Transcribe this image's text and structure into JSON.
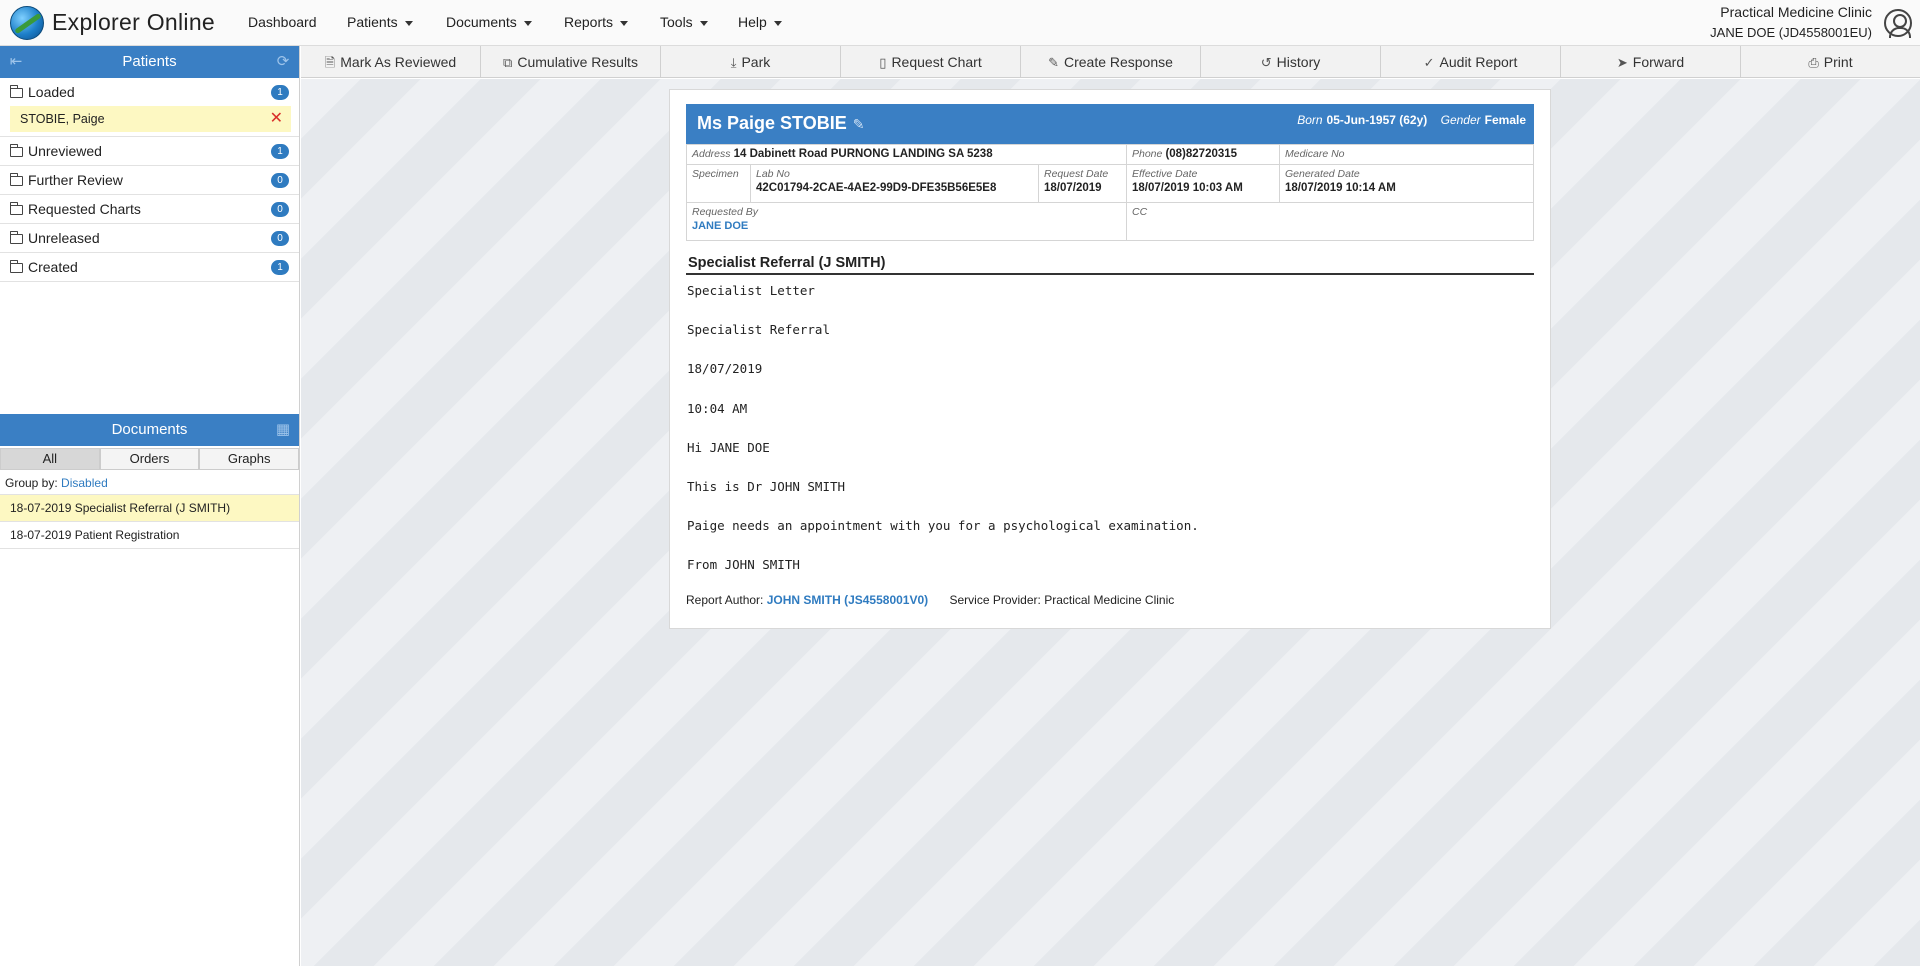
{
  "app": {
    "title": "Explorer Online"
  },
  "nav": {
    "items": [
      {
        "label": "Dashboard"
      },
      {
        "label": "Patients"
      },
      {
        "label": "Documents"
      },
      {
        "label": "Reports"
      },
      {
        "label": "Tools"
      },
      {
        "label": "Help"
      }
    ]
  },
  "user": {
    "clinic": "Practical Medicine Clinic",
    "name": "JANE DOE (JD4558001EU)"
  },
  "patients_panel": {
    "title": "Patients",
    "folders": [
      {
        "label": "Loaded",
        "count": "1"
      },
      {
        "label": "Unreviewed",
        "count": "1"
      },
      {
        "label": "Further Review",
        "count": "0"
      },
      {
        "label": "Requested Charts",
        "count": "0"
      },
      {
        "label": "Unreleased",
        "count": "0"
      },
      {
        "label": "Created",
        "count": "1"
      }
    ],
    "loaded_patient": "STOBIE, Paige"
  },
  "documents_panel": {
    "title": "Documents",
    "tabs": [
      "All",
      "Orders",
      "Graphs"
    ],
    "group_by_label": "Group by:",
    "group_by_value": "Disabled",
    "items": [
      {
        "label": "18-07-2019 Specialist Referral (J SMITH)"
      },
      {
        "label": "18-07-2019 Patient Registration"
      }
    ]
  },
  "toolbar": {
    "buttons": [
      {
        "label": "Mark As Reviewed",
        "icon": "check-doc-icon"
      },
      {
        "label": "Cumulative Results",
        "icon": "copy-icon"
      },
      {
        "label": "Park",
        "icon": "download-tray-icon"
      },
      {
        "label": "Request Chart",
        "icon": "clipboard-icon"
      },
      {
        "label": "Create Response",
        "icon": "edit-icon"
      },
      {
        "label": "History",
        "icon": "history-icon"
      },
      {
        "label": "Audit Report",
        "icon": "check-circle-icon"
      },
      {
        "label": "Forward",
        "icon": "send-icon"
      },
      {
        "label": "Print",
        "icon": "print-icon"
      }
    ]
  },
  "report": {
    "patient_name": "Ms Paige STOBIE",
    "born_label": "Born",
    "born_value": "05-Jun-1957 (62y)",
    "gender_label": "Gender",
    "gender_value": "Female",
    "address_label": "Address",
    "address_value": "14 Dabinett Road PURNONG LANDING SA 5238",
    "phone_label": "Phone",
    "phone_value": "(08)82720315",
    "medicare_label": "Medicare No",
    "specimen_label": "Specimen",
    "lab_no_label": "Lab No",
    "lab_no_value": "42C01794-2CAE-4AE2-99D9-DFE35B56E5E8",
    "request_date_label": "Request Date",
    "request_date_value": "18/07/2019",
    "effective_date_label": "Effective Date",
    "effective_date_value": "18/07/2019 10:03 AM",
    "generated_date_label": "Generated Date",
    "generated_date_value": "18/07/2019 10:14 AM",
    "requested_by_label": "Requested By",
    "requested_by_value": "JANE DOE",
    "cc_label": "CC",
    "title": "Specialist Referral (J SMITH)",
    "body_lines": [
      "Specialist Letter",
      "Specialist Referral",
      "18/07/2019",
      "10:04 AM",
      "Hi JANE DOE",
      "This is Dr JOHN SMITH",
      "Paige needs an appointment with you for a psychological examination.",
      "From JOHN SMITH"
    ],
    "author_label": "Report Author:",
    "author_value": "JOHN SMITH (JS4558001V0)",
    "provider_label": "Service Provider:",
    "provider_value": "Practical Medicine Clinic"
  }
}
